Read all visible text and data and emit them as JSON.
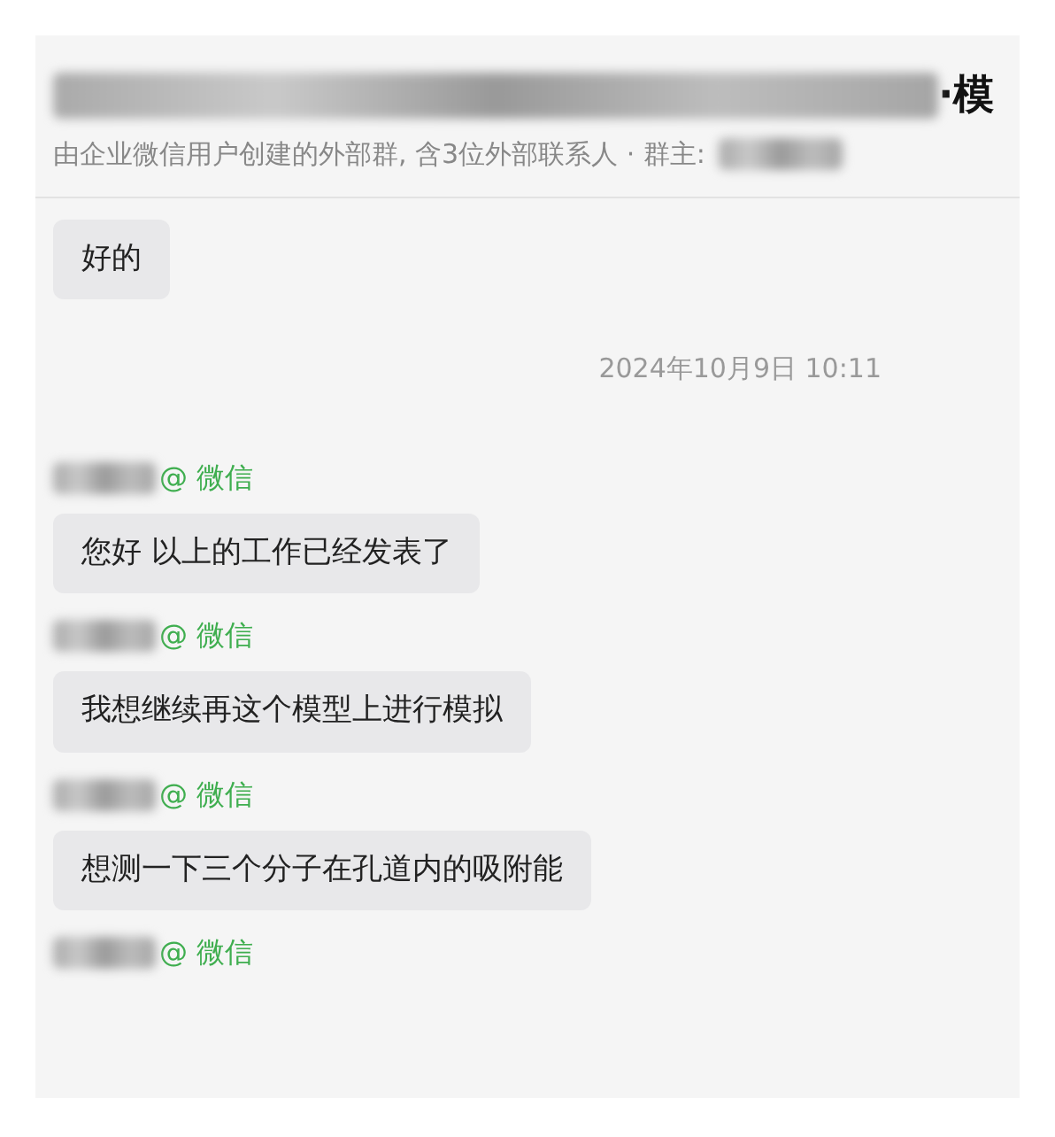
{
  "header": {
    "title": "·模",
    "subtitle": "由企业微信用户创建的外部群, 含3位外部联系人 · 群主:"
  },
  "messages": [
    {
      "kind": "bubble",
      "text": "好的"
    },
    {
      "kind": "timestamp",
      "text": "2024年10月9日 10:11"
    },
    {
      "kind": "sender",
      "tag": "@ 微信"
    },
    {
      "kind": "bubble",
      "text": "您好 以上的工作已经发表了"
    },
    {
      "kind": "sender",
      "tag": "@ 微信"
    },
    {
      "kind": "bubble",
      "text": "我想继续再这个模型上进行模拟"
    },
    {
      "kind": "sender",
      "tag": "@ 微信"
    },
    {
      "kind": "bubble",
      "text": "想测一下三个分子在孔道内的吸附能"
    },
    {
      "kind": "sender",
      "tag": "@ 微信"
    }
  ]
}
